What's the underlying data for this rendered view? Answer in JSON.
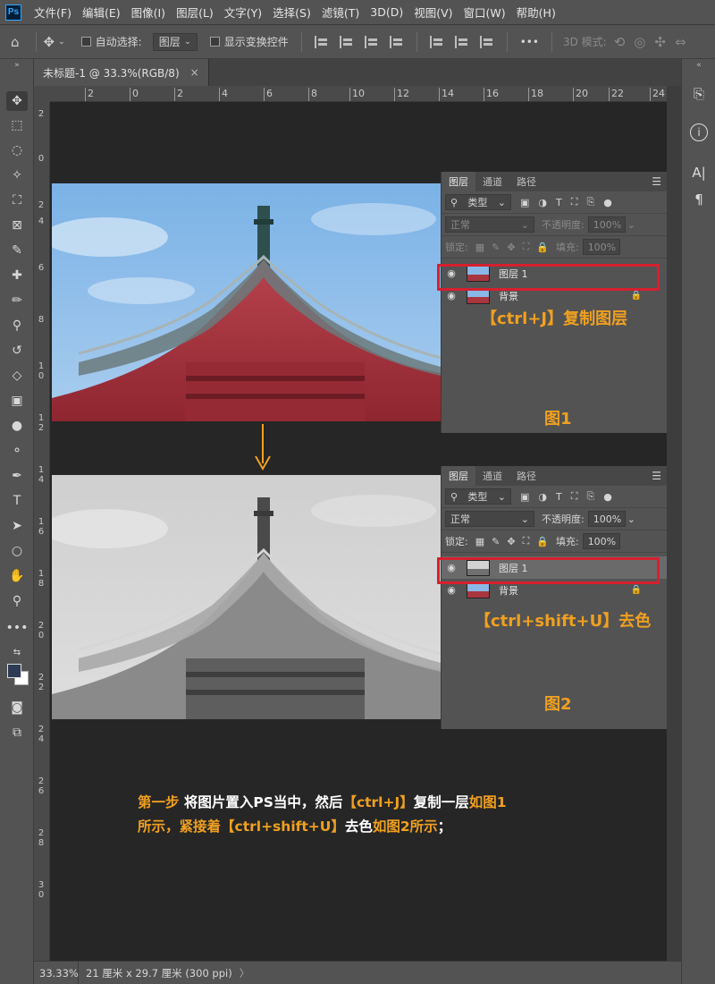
{
  "app": {
    "logo": "Ps"
  },
  "menu": [
    "文件(F)",
    "编辑(E)",
    "图像(I)",
    "图层(L)",
    "文字(Y)",
    "选择(S)",
    "滤镜(T)",
    "3D(D)",
    "视图(V)",
    "窗口(W)",
    "帮助(H)"
  ],
  "options": {
    "auto_select_label": "自动选择:",
    "auto_select_value": "图层",
    "show_transform_label": "显示变换控件",
    "more": "•••",
    "mode_3d_label": "3D 模式:"
  },
  "tab": {
    "title": "未标题-1 @ 33.3%(RGB/8)",
    "close": "×"
  },
  "toolbar": {
    "collapse": "»"
  },
  "dock": {
    "collapse": "«"
  },
  "ruler_top": [
    "2",
    "0",
    "2",
    "4",
    "6",
    "8",
    "10",
    "12",
    "14",
    "16",
    "18",
    "20",
    "22",
    "24"
  ],
  "ruler_left": [
    "2",
    "0",
    "2",
    "4",
    "6",
    "8",
    "1\n0",
    "1\n2",
    "1\n4",
    "1\n6",
    "1\n8",
    "2\n0",
    "2\n2",
    "2\n4",
    "2\n6",
    "2\n8",
    "3\n0"
  ],
  "panel1": {
    "tabs": [
      "图层",
      "通道",
      "路径"
    ],
    "filter": "类型",
    "blend": "正常",
    "opacity_label": "不透明度:",
    "opacity": "100%",
    "lock_label": "锁定:",
    "fill_label": "填充:",
    "fill": "100%",
    "layers": [
      {
        "name": "图层 1"
      },
      {
        "name": "背景"
      }
    ],
    "annotation": "【ctrl+J】复制图层",
    "figure": "图1"
  },
  "panel2": {
    "tabs": [
      "图层",
      "通道",
      "路径"
    ],
    "filter": "类型",
    "blend": "正常",
    "opacity_label": "不透明度:",
    "opacity": "100%",
    "lock_label": "锁定:",
    "fill_label": "填充:",
    "fill": "100%",
    "layers": [
      {
        "name": "图层 1"
      },
      {
        "name": "背景"
      }
    ],
    "annotation": "【ctrl+shift+U】去色",
    "figure": "图2"
  },
  "caption": {
    "p1": "第一步",
    "p2": " 将图片置入PS当中，然后",
    "p3": "【ctrl+J】",
    "p4": "复制一层",
    "p5": "如图1",
    "p6": "所示，紧接着",
    "p7": "【ctrl+shift+U】",
    "p8": "去色",
    "p9": "如图2所示",
    "p10": "；"
  },
  "status": {
    "zoom": "33.33%",
    "doc_size": "21 厘米 x 29.7 厘米 (300 ppi)",
    "arrow": "〉"
  },
  "colors": {
    "accent": "#f0a020",
    "highlight_box": "#d6202f",
    "canvas": "#262626",
    "ui": "#535353"
  }
}
